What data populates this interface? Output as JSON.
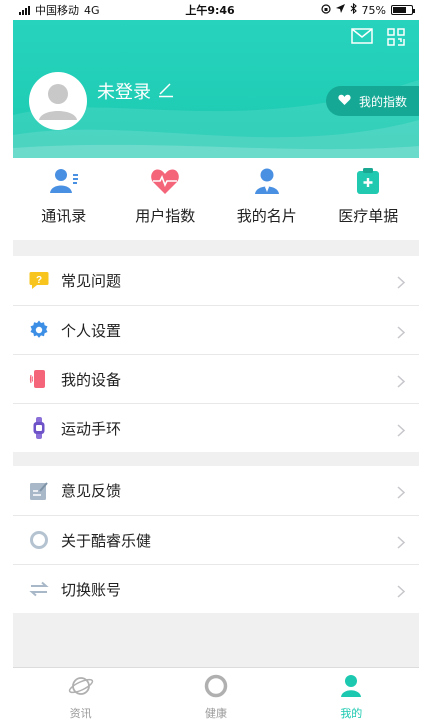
{
  "status_bar": {
    "carrier": "中国移动",
    "network": "4G",
    "time": "上午9:46",
    "battery": "75%"
  },
  "header": {
    "login_text": "未登录",
    "index_button_label": "我的指数",
    "icons": [
      "mail-icon",
      "qr-code-icon",
      "edit-icon",
      "heart-icon"
    ]
  },
  "quick_actions": [
    {
      "label": "通讯录",
      "icon": "contacts-icon"
    },
    {
      "label": "用户指数",
      "icon": "heart-pulse-icon"
    },
    {
      "label": "我的名片",
      "icon": "user-card-icon"
    },
    {
      "label": "医疗单据",
      "icon": "medical-record-icon"
    }
  ],
  "menu_group_1": [
    {
      "label": "常见问题",
      "icon": "faq-icon"
    },
    {
      "label": "个人设置",
      "icon": "gear-icon"
    },
    {
      "label": "我的设备",
      "icon": "phone-device-icon"
    },
    {
      "label": "运动手环",
      "icon": "wristband-icon"
    }
  ],
  "menu_group_2": [
    {
      "label": "意见反馈",
      "icon": "feedback-icon"
    },
    {
      "label": "关于酷睿乐健",
      "icon": "ring-icon"
    },
    {
      "label": "切换账号",
      "icon": "switch-icon"
    }
  ],
  "tab_bar": [
    {
      "label": "资讯",
      "icon": "planet-icon"
    },
    {
      "label": "健康",
      "icon": "ring-icon"
    },
    {
      "label": "我的",
      "icon": "person-icon",
      "active": true
    }
  ],
  "colors": {
    "accent": "#1cc9b0",
    "accent_dark": "#15a995",
    "background": "#f0f0f0"
  }
}
